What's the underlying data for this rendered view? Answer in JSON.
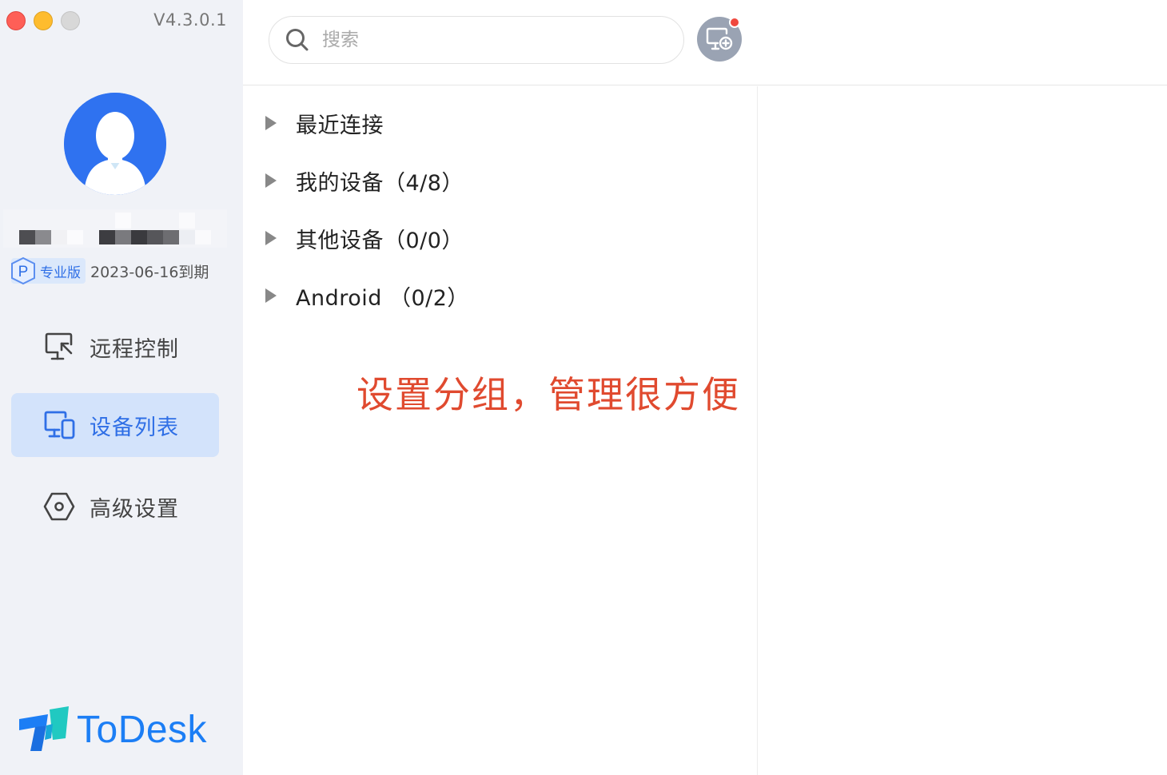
{
  "window": {
    "version": "V4.3.0.1"
  },
  "profile": {
    "plan_label": "专业版",
    "plan_badge_letter": "P",
    "expiry": "2023-06-16到期"
  },
  "nav": [
    {
      "label": "远程控制",
      "icon": "remote-control-icon",
      "active": false
    },
    {
      "label": "设备列表",
      "icon": "device-list-icon",
      "active": true
    },
    {
      "label": "高级设置",
      "icon": "settings-icon",
      "active": false
    }
  ],
  "brand": {
    "name": "ToDesk",
    "color": "#1c7ef5"
  },
  "search": {
    "placeholder": "搜索",
    "value": ""
  },
  "tree": [
    {
      "label": "最近连接"
    },
    {
      "label": "我的设备（4/8）"
    },
    {
      "label": "其他设备（0/0）"
    },
    {
      "label": "Android （0/2）"
    }
  ],
  "annotation": {
    "text": "设置分组，管理很方便",
    "color": "#e04a2f"
  },
  "colors": {
    "accent": "#2f6fe6",
    "sidebar_bg": "#f0f2f7",
    "active_nav_bg": "#d3e3fb",
    "notify": "#f0483e"
  }
}
